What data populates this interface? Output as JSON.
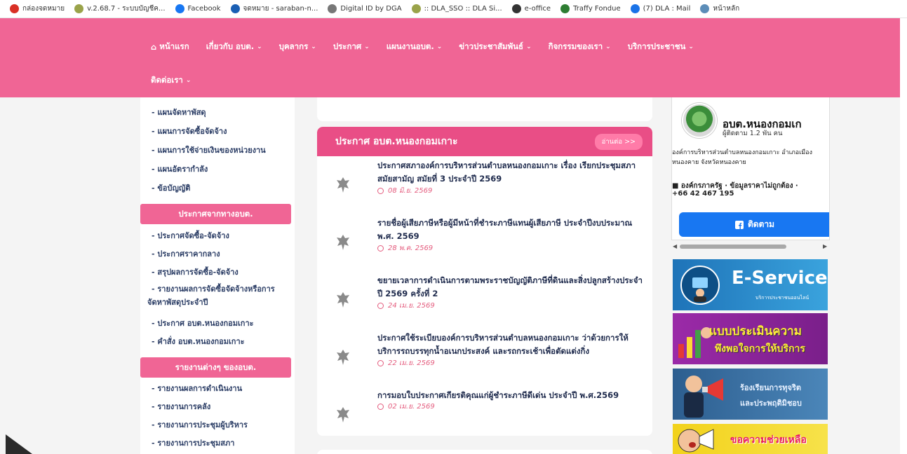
{
  "bookmarks": [
    {
      "label": "กล่องจดหมาย",
      "color": "#d93025"
    },
    {
      "label": "v.2.68.7 - ระบบบัญชีค...",
      "color": "#9aa34a"
    },
    {
      "label": "Facebook",
      "color": "#1877f2"
    },
    {
      "label": "จดหมาย - saraban-n...",
      "color": "#1a5fb4"
    },
    {
      "label": "Digital ID by DGA",
      "color": "#777777"
    },
    {
      "label": ":: DLA_SSO :: DLA Si...",
      "color": "#9aa34a"
    },
    {
      "label": "e-office",
      "color": "#333333"
    },
    {
      "label": "Traffy Fondue",
      "color": "#2e7d32"
    },
    {
      "label": "(7) DLA : Mail",
      "color": "#1a73e8"
    },
    {
      "label": "หน้าหลัก",
      "color": "#5c8db8"
    }
  ],
  "nav": {
    "row1": [
      "หน้าแรก",
      "เกี่ยวกับ อบต.",
      "บุคลากร",
      "ประกาศ",
      "แผนงานอบต.",
      "ข่าวประชาสัมพันธ์",
      "กิจกรรมของเรา",
      "บริการประชาชน"
    ],
    "row2": [
      "ติดต่อเรา"
    ]
  },
  "sidebar": {
    "group1_links": [
      "- แผนจัดหาพัสดุ",
      "- แผนการจัดซื้อจัดจ้าง",
      "- แผนการใช้จ่ายเงินของหน่วยงาน",
      "- แผนอัตรากำลัง",
      "- ข้อบัญญัติ"
    ],
    "group2_title": "ประกาศจากทางอบต.",
    "group2_links": [
      "- ประกาศจัดซื้อ-จัดจ้าง",
      "- ประกาศราคากลาง",
      "- สรุปผลการจัดซื้อ-จัดจ้าง",
      "- รายงานผลการจัดซื้อจัดจ้างหรือการจัดหาพัสดุประจำปี",
      "- ประกาศ อบต.หนองกอมเกาะ",
      "- คำสั่ง อบต.หนองกอมเกาะ"
    ],
    "group3_title": "รายงานต่างๆ ของอบต.",
    "group3_links": [
      "- รายงานผลการดำเนินงาน",
      "- รายงานการคลัง",
      "- รายงานการประชุมผู้บริหาร",
      "- รายงานการประชุมสภา"
    ]
  },
  "announcements": {
    "title": "ประกาศ อบต.หนองกอมเกาะ",
    "more_label": "อ่านต่อ >>",
    "items": [
      {
        "title": "ประกาศสภาองค์การบริหารส่วนตำบลหนองกอมเกาะ เรื่อง เรียกประชุมสภาสมัยสามัญ สมัยที่ 3 ประจำปี 2569",
        "date": "08 มิ.ย. 2569"
      },
      {
        "title": "รายชื่อผู้เสียภาษีหรือผู้มีหน้าที่ชำระภาษีแทนผู้เสียภาษี ประจำปีงบประมาณ พ.ศ. 2569",
        "date": "28 พ.ค. 2569"
      },
      {
        "title": "ขยายเวลาการดำเนินการตามพระราชบัญญัติภาษีที่ดินและสิ่งปลูกสร้างประจำปี 2569 ครั้งที่ 2",
        "date": "24 เม.ย. 2569"
      },
      {
        "title": "ประกาศใช้ระเบียบองค์การบริหารส่วนตำบลหนองกอมเกาะ ว่าด้วยการให้บริการรถบรรทุกน้ำอเนกประสงค์ และรถกระเช้าเพื่อตัดแต่งกิ่ง",
        "date": "22 เม.ย. 2569"
      },
      {
        "title": "การมอบใบประกาศเกียรติคุณแก่ผู้ชำระภาษีดีเด่น ประจำปี พ.ศ.2569",
        "date": "02 เม.ย. 2569"
      }
    ]
  },
  "facebook": {
    "page_name": "อบต.หนองกอมเก",
    "followers": "ผู้ติดตาม 1.2 พัน คน",
    "description": "องค์การบริหารส่วนตำบลหนองกอมเกาะ อำเภอเมืองหนองคาย จังหวัดหนองคาย",
    "category": "■ องค์กรภาครัฐ · ข้อมูลราคาไม่ถูกต้อง ·",
    "phone": "+66 42 467 195",
    "follow_label": "ติดตาม"
  },
  "banners": {
    "eservice_title": "E-Service",
    "eservice_sub": "บริการประชาชนออนไลน์",
    "survey_line1": "แบบประเมินความ",
    "survey_line2": "พึงพอใจการให้บริการ",
    "complaint_line1": "ร้องเรียนการทุจริต",
    "complaint_line2": "และประพฤติมิชอบ",
    "help_text": "ขอความช่วยเหลือ"
  },
  "colors": {
    "pink_nav": "#f06595",
    "card_header": "#e94e86",
    "facebook_blue": "#1877f2"
  }
}
